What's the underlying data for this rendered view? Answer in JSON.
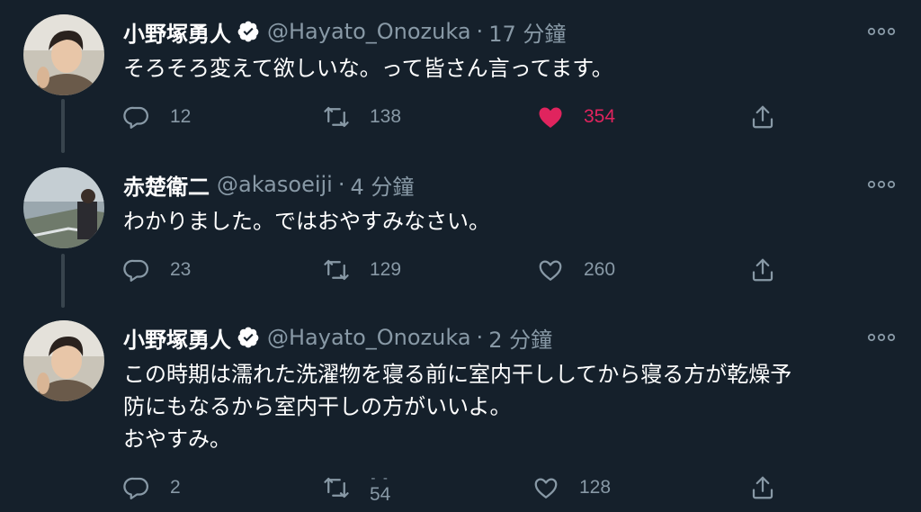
{
  "tweets": [
    {
      "name": "小野塚勇人",
      "verified": true,
      "handle": "@Hayato_Onozuka",
      "separator": "·",
      "time": "17 分鐘",
      "text": "そろそろ変えて欲しいな。って皆さん言ってます。",
      "replies": "12",
      "retweets": "138",
      "likes": "354",
      "liked": true
    },
    {
      "name": "赤楚衛二",
      "verified": false,
      "handle": "@akasoeiji",
      "separator": "·",
      "time": "4 分鐘",
      "text": "わかりました。ではおやすみなさい。",
      "replies": "23",
      "retweets": "129",
      "likes": "260",
      "liked": false
    },
    {
      "name": "小野塚勇人",
      "verified": true,
      "handle": "@Hayato_Onozuka",
      "separator": "·",
      "time": "2 分鐘",
      "text": "この時期は濡れた洗濯物を寝る前に室内干ししてから寝る方が乾燥予\n防にもなるから室内干しの方がいいよ。\nおやすみ。",
      "replies": "2",
      "retweets": "54",
      "retweets_top": "- -",
      "likes": "128",
      "liked": false
    }
  ],
  "colors": {
    "background": "#15202b",
    "text": "#ffffff",
    "secondary": "#8899a6",
    "like": "#e0245e",
    "thread": "#38444d",
    "verified_badge": "#ffffff"
  },
  "icons": {
    "reply": "reply-icon",
    "retweet": "retweet-icon",
    "like": "heart-icon",
    "share": "share-icon",
    "more": "more-icon",
    "verified": "verified-icon"
  }
}
